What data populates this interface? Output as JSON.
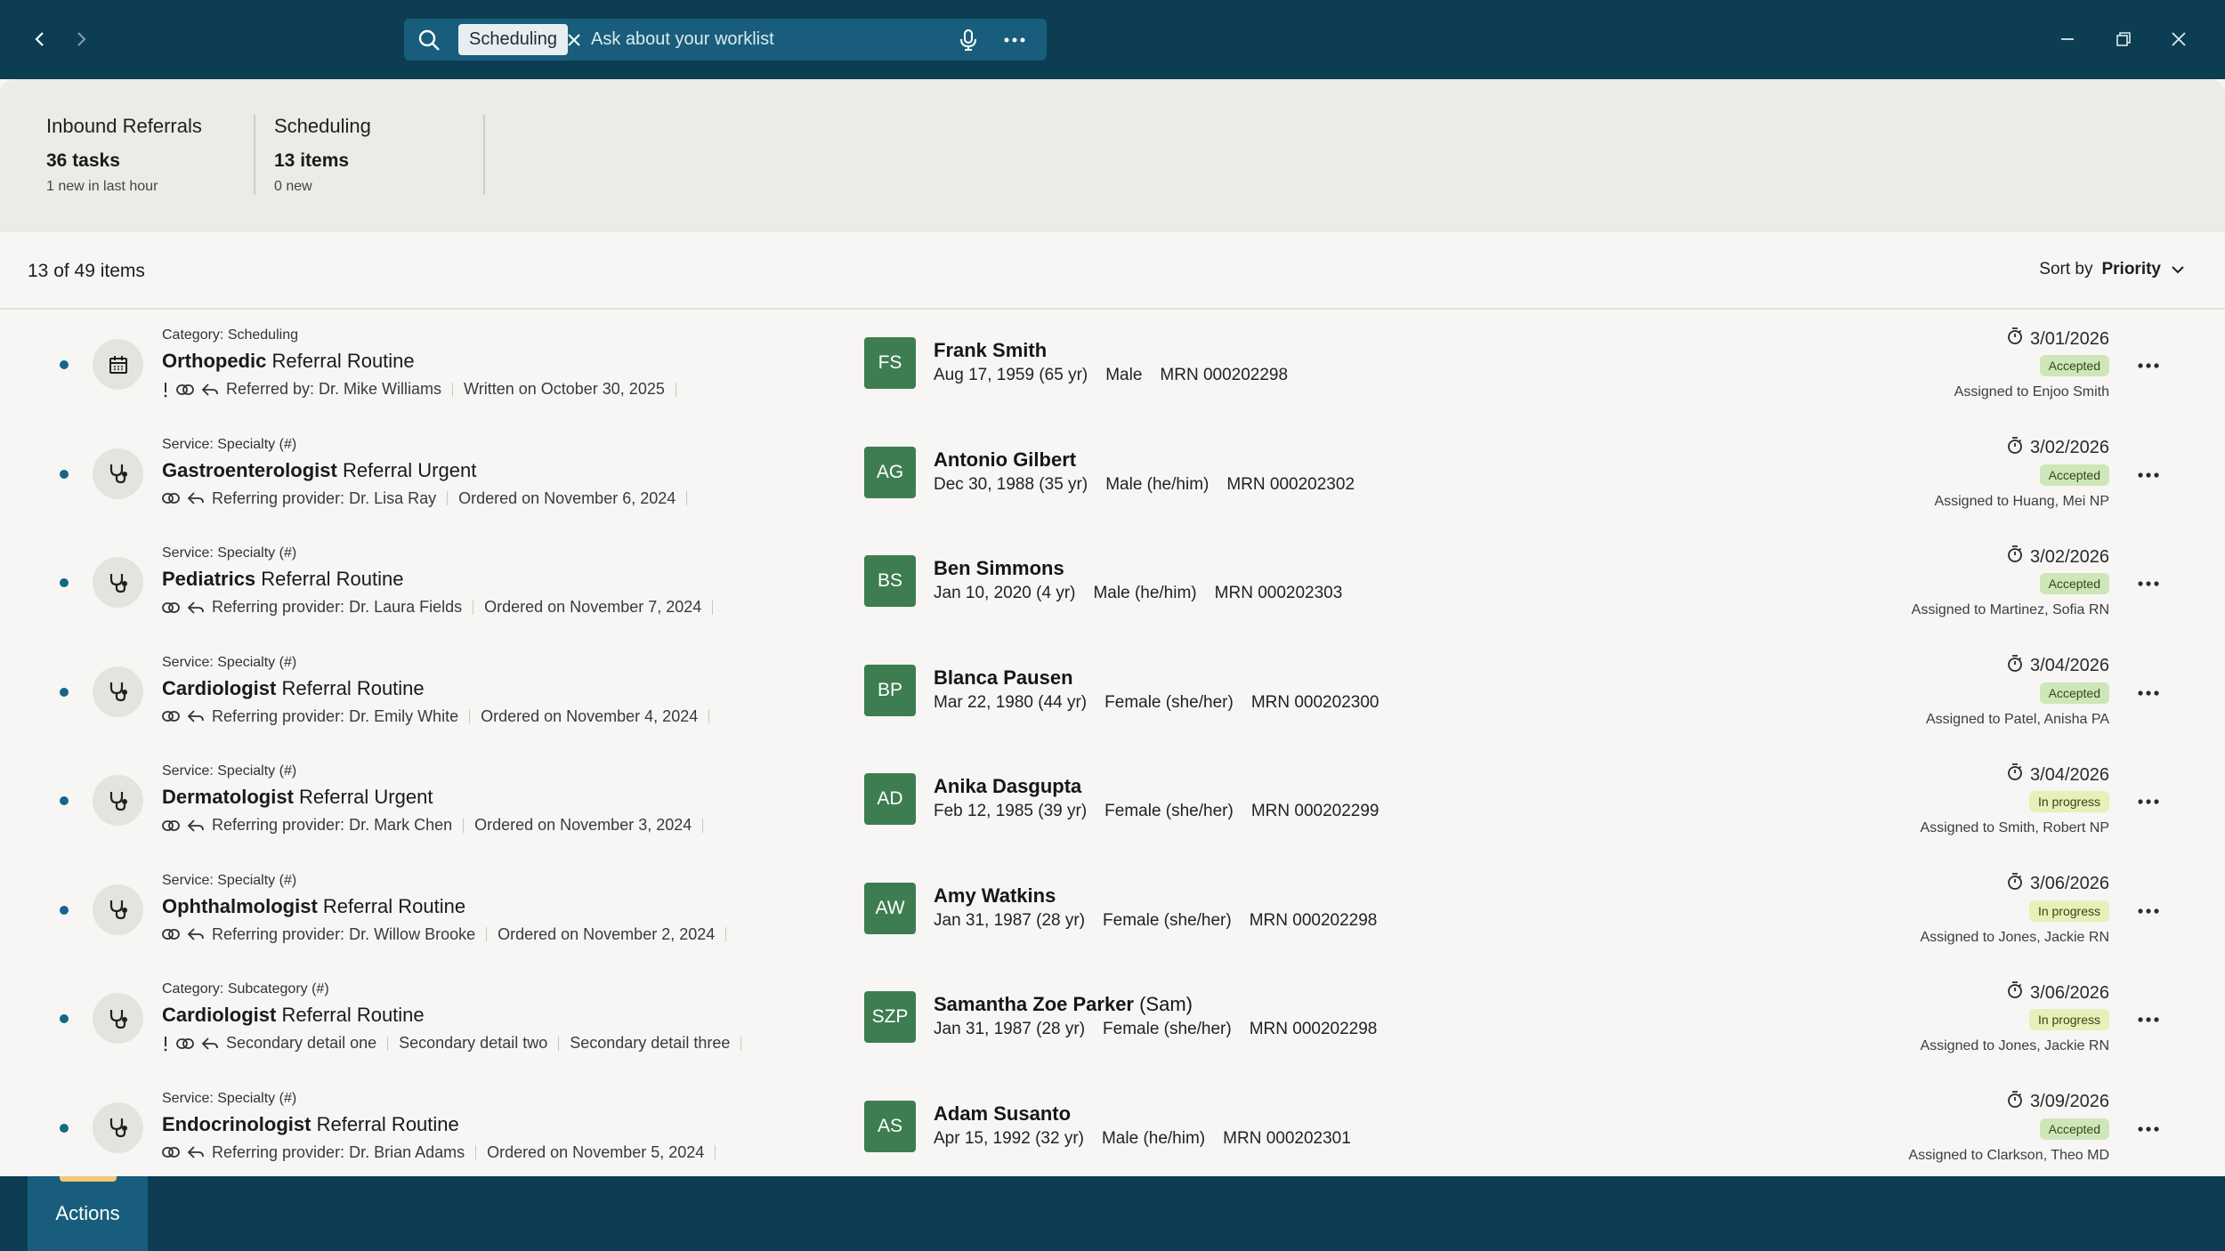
{
  "search": {
    "chip_label": "Scheduling",
    "placeholder": "Ask about your worklist"
  },
  "summary": [
    {
      "title": "Inbound Referrals",
      "count": "36 tasks",
      "sub": "1 new in last hour"
    },
    {
      "title": "Scheduling",
      "count": "13 items",
      "sub": "0 new"
    }
  ],
  "list": {
    "count_label": "13 of 49 items",
    "sort_prefix": "Sort by",
    "sort_value": "Priority"
  },
  "colors": {
    "topbar": "#0c3d52",
    "accent": "#13668c",
    "avatar": "#3e7d51",
    "accepted_badge": "#cfe6b8",
    "in_progress_badge": "#e8efb8"
  },
  "rows": [
    {
      "icon": "calendar-icon",
      "category": "Category: Scheduling",
      "specialty": "Orthopedic",
      "title_rest": "Referral Routine",
      "alert": true,
      "details": [
        "Referred by: Dr. Mike Williams",
        "Written on October 30, 2025"
      ],
      "initials": "FS",
      "name": "Frank Smith",
      "nickname": "",
      "dob": "Aug 17, 1959 (65 yr)",
      "sex": "Male",
      "mrn": "MRN 000202298",
      "due": "3/01/2026",
      "status": "Accepted",
      "status_type": "accepted",
      "assigned": "Assigned to Enjoo Smith"
    },
    {
      "icon": "stethoscope-icon",
      "category": "Service: Specialty (#)",
      "specialty": "Gastroenterologist",
      "title_rest": "Referral Urgent",
      "alert": false,
      "details": [
        "Referring provider: Dr. Lisa Ray",
        "Ordered on November 6, 2024"
      ],
      "initials": "AG",
      "name": "Antonio Gilbert",
      "nickname": "",
      "dob": "Dec 30, 1988 (35 yr)",
      "sex": "Male (he/him)",
      "mrn": "MRN 000202302",
      "due": "3/02/2026",
      "status": "Accepted",
      "status_type": "accepted",
      "assigned": "Assigned to Huang, Mei NP"
    },
    {
      "icon": "stethoscope-icon",
      "category": "Service: Specialty (#)",
      "specialty": "Pediatrics",
      "title_rest": "Referral Routine",
      "alert": false,
      "details": [
        "Referring provider: Dr. Laura Fields",
        "Ordered on November 7, 2024"
      ],
      "initials": "BS",
      "name": "Ben Simmons",
      "nickname": "",
      "dob": "Jan 10, 2020 (4 yr)",
      "sex": "Male (he/him)",
      "mrn": "MRN 000202303",
      "due": "3/02/2026",
      "status": "Accepted",
      "status_type": "accepted",
      "assigned": "Assigned to Martinez, Sofia RN"
    },
    {
      "icon": "stethoscope-icon",
      "category": "Service: Specialty (#)",
      "specialty": "Cardiologist",
      "title_rest": "Referral Routine",
      "alert": false,
      "details": [
        "Referring provider: Dr. Emily White",
        "Ordered on November 4, 2024"
      ],
      "initials": "BP",
      "name": "Blanca Pausen",
      "nickname": "",
      "dob": "Mar 22, 1980 (44 yr)",
      "sex": "Female (she/her)",
      "mrn": "MRN 000202300",
      "due": "3/04/2026",
      "status": "Accepted",
      "status_type": "accepted",
      "assigned": "Assigned to Patel, Anisha PA"
    },
    {
      "icon": "stethoscope-icon",
      "category": "Service: Specialty (#)",
      "specialty": "Dermatologist",
      "title_rest": "Referral Urgent",
      "alert": false,
      "details": [
        "Referring provider: Dr. Mark Chen",
        "Ordered on November 3, 2024"
      ],
      "initials": "AD",
      "name": "Anika Dasgupta",
      "nickname": "",
      "dob": "Feb 12, 1985 (39 yr)",
      "sex": "Female (she/her)",
      "mrn": "MRN 000202299",
      "due": "3/04/2026",
      "status": "In progress",
      "status_type": "progress",
      "assigned": "Assigned to Smith, Robert NP"
    },
    {
      "icon": "stethoscope-icon",
      "category": "Service: Specialty (#)",
      "specialty": "Ophthalmologist",
      "title_rest": "Referral Routine",
      "alert": false,
      "details": [
        "Referring provider: Dr. Willow Brooke",
        "Ordered on November 2, 2024"
      ],
      "initials": "AW",
      "name": "Amy Watkins",
      "nickname": "",
      "dob": "Jan 31, 1987 (28 yr)",
      "sex": "Female (she/her)",
      "mrn": "MRN 000202298",
      "due": "3/06/2026",
      "status": "In progress",
      "status_type": "progress",
      "assigned": "Assigned to Jones, Jackie RN"
    },
    {
      "icon": "stethoscope-icon",
      "category": "Category: Subcategory (#)",
      "specialty": "Cardiologist",
      "title_rest": "Referral Routine",
      "alert": true,
      "details": [
        "Secondary detail one",
        "Secondary detail two",
        "Secondary detail three"
      ],
      "initials": "SZP",
      "name": "Samantha Zoe Parker",
      "nickname": "(Sam)",
      "dob": "Jan 31, 1987 (28 yr)",
      "sex": "Female (she/her)",
      "mrn": "MRN 000202298",
      "due": "3/06/2026",
      "status": "In progress",
      "status_type": "progress",
      "assigned": "Assigned to Jones, Jackie RN"
    },
    {
      "icon": "stethoscope-icon",
      "category": "Service: Specialty (#)",
      "specialty": "Endocrinologist",
      "title_rest": "Referral Routine",
      "alert": false,
      "details": [
        "Referring provider: Dr. Brian Adams",
        "Ordered on November 5, 2024"
      ],
      "initials": "AS",
      "name": "Adam Susanto",
      "nickname": "",
      "dob": "Apr 15, 1992 (32 yr)",
      "sex": "Male (he/him)",
      "mrn": "MRN 000202301",
      "due": "3/09/2026",
      "status": "Accepted",
      "status_type": "accepted",
      "assigned": "Assigned to Clarkson, Theo MD"
    }
  ],
  "bottom": {
    "actions_label": "Actions"
  }
}
